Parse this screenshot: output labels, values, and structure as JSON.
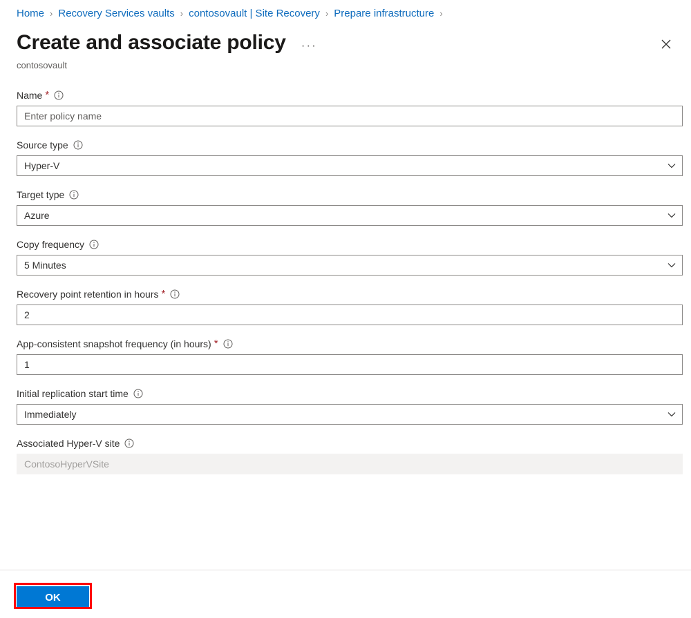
{
  "breadcrumb": {
    "separator": "›",
    "items": [
      {
        "label": "Home"
      },
      {
        "label": "Recovery Services vaults"
      },
      {
        "label": "contosovault | Site Recovery"
      },
      {
        "label": "Prepare infrastructure"
      }
    ]
  },
  "header": {
    "title": "Create and associate policy",
    "subtitle": "contosovault",
    "more_label": "···",
    "more_icon": "ellipsis-icon",
    "close_icon": "close-icon"
  },
  "form": {
    "info_icon": "info-icon",
    "chevron_icon": "chevron-down-icon",
    "required_marker": "*",
    "fields": [
      {
        "id": "name",
        "label": "Name",
        "required": true,
        "type": "text",
        "value": "",
        "placeholder": "Enter policy name"
      },
      {
        "id": "source-type",
        "label": "Source type",
        "required": false,
        "type": "select",
        "value": "Hyper-V"
      },
      {
        "id": "target-type",
        "label": "Target type",
        "required": false,
        "type": "select",
        "value": "Azure"
      },
      {
        "id": "copy-frequency",
        "label": "Copy frequency",
        "required": false,
        "type": "select",
        "value": "5 Minutes"
      },
      {
        "id": "recovery-point-retention",
        "label": "Recovery point retention in hours",
        "required": true,
        "type": "text",
        "value": "2",
        "placeholder": ""
      },
      {
        "id": "app-consistent-snapshot-frequency",
        "label": "App-consistent snapshot frequency (in hours)",
        "required": true,
        "type": "text",
        "value": "1",
        "placeholder": ""
      },
      {
        "id": "initial-replication-start-time",
        "label": "Initial replication start time",
        "required": false,
        "type": "select",
        "value": "Immediately"
      },
      {
        "id": "associated-hyper-v-site",
        "label": "Associated Hyper-V site",
        "required": false,
        "type": "disabled",
        "value": "ContosoHyperVSite"
      }
    ]
  },
  "footer": {
    "ok_label": "OK"
  },
  "colors": {
    "link": "#0f6cbd",
    "primary_button": "#0078d4",
    "required_asterisk": "#a4262c",
    "annotation": "#ff0000",
    "border": "#8a8886",
    "disabled_bg": "#f3f2f1"
  }
}
